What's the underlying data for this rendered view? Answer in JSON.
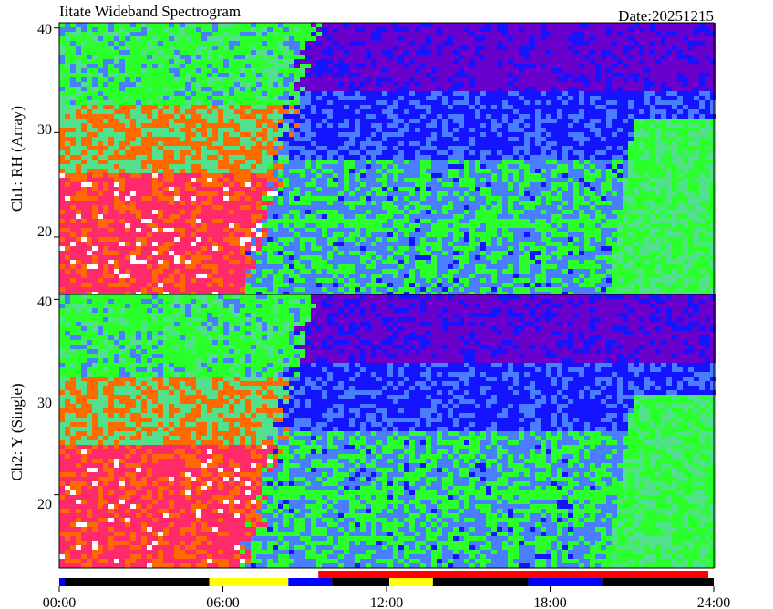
{
  "chart_data": {
    "type": "heatmap",
    "title": "Iitate Wideband Spectrogram",
    "date_label": "Date:20251215",
    "x_tick_labels": [
      "00:00",
      "06:00",
      "12:00",
      "18:00",
      "24:00"
    ],
    "x_ticks_hours": [
      0,
      6,
      12,
      18,
      24
    ],
    "xlim_hours": [
      0,
      24
    ],
    "panels": [
      {
        "ylabel": "Ch1: RH (Array)",
        "ylim": [
          14.5,
          40.5
        ],
        "y_tick_values": [
          20,
          30,
          40
        ],
        "y_tick_labels": [
          "20",
          "30",
          "40"
        ]
      },
      {
        "ylabel": "Ch2: Y (Single)",
        "ylim": [
          12.5,
          40.5
        ],
        "y_tick_values": [
          20,
          30,
          40
        ],
        "y_tick_labels": [
          "20",
          "30",
          "40"
        ]
      }
    ],
    "colormap": [
      "#ffffff",
      "#ff2a6a",
      "#ff6a00",
      "#52e08c",
      "#2bff2b",
      "#4a7dff",
      "#1414ff",
      "#6a00cc"
    ],
    "status_bars": [
      {
        "row": "upper",
        "segments": [
          {
            "start_h": 9.5,
            "end_h": 23.8,
            "color": "#ff0000"
          }
        ]
      },
      {
        "row": "lower",
        "segments": [
          {
            "start_h": 0.0,
            "end_h": 0.2,
            "color": "#0000ff"
          },
          {
            "start_h": 0.2,
            "end_h": 5.5,
            "color": "#000000"
          },
          {
            "start_h": 5.5,
            "end_h": 8.4,
            "color": "#ffff00"
          },
          {
            "start_h": 8.4,
            "end_h": 10.0,
            "color": "#0000ff"
          },
          {
            "start_h": 10.0,
            "end_h": 12.1,
            "color": "#000000"
          },
          {
            "start_h": 12.1,
            "end_h": 13.7,
            "color": "#ffff00"
          },
          {
            "start_h": 13.7,
            "end_h": 17.2,
            "color": "#000000"
          },
          {
            "start_h": 17.2,
            "end_h": 19.9,
            "color": "#0000ff"
          },
          {
            "start_h": 19.9,
            "end_h": 24.0,
            "color": "#000000"
          }
        ]
      }
    ]
  }
}
